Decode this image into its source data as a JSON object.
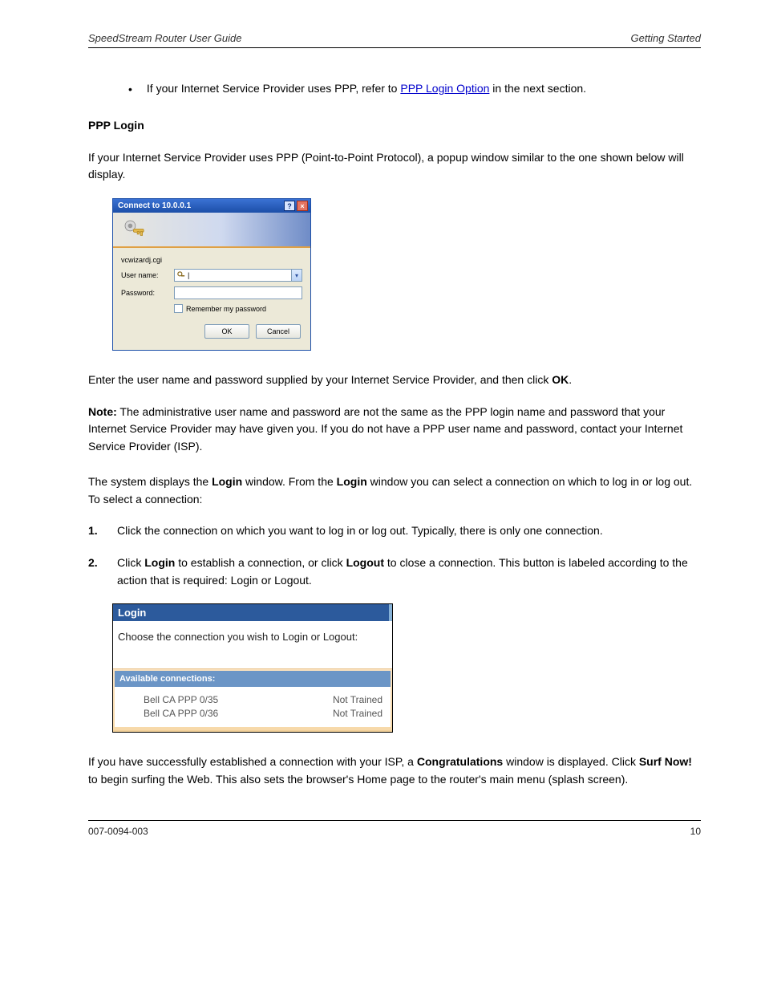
{
  "header": {
    "left": "SpeedStream Router User Guide",
    "right": "Getting Started"
  },
  "bullet": {
    "text_before": "If your Internet Service Provider uses PPP, refer to ",
    "link_text": "PPP Login Option",
    "text_after": " in the next section."
  },
  "paras": {
    "ppp_heading": "PPP Login",
    "ppp_intro": "If your Internet Service Provider uses PPP (Point-to-Point Protocol), a popup window similar to the one shown below will display."
  },
  "xp": {
    "title": "Connect to 10.0.0.1",
    "realm": "vcwizardj.cgi",
    "username_label": "User name:",
    "password_label": "Password:",
    "remember_label": "Remember my password",
    "ok": "OK",
    "cancel": "Cancel"
  },
  "after_dialog": {
    "enter_creds": "Enter the user name and password supplied by your Internet Service Provider, and then click ",
    "ok_word": "OK",
    "period": ".",
    "note_label": "Note:",
    "note_text": " The administrative user name and password are not the same as the PPP login name and password that your Internet Service Provider may have given you. If you do not have a PPP user name and password, contact your Internet Service Provider (ISP)."
  },
  "login_steps": {
    "intro": ":",
    "login_word": "Login",
    "intro_prefix": "The system displays the ",
    "intro_middle": " window. From the ",
    "intro_suffix": " window you can select a connection on which to log in or log out. To select a connection",
    "step1_num": "1.",
    "step1_text": "Click the connection on which you want to log in or log out. Typically, there is only one connection.",
    "step2_num": "2.",
    "step2_text_prefix": "Click ",
    "step2_login": "Login",
    "step2_text_mid": " to establish a connection, or click ",
    "step2_logout": "Logout",
    "step2_text_suffix": " to close a connection. This button is labeled according to the action that is required: Login or Logout."
  },
  "loginpanel": {
    "title": "Login",
    "prompt": "Choose the connection you wish to Login or Logout:",
    "subtitle": "Available connections:",
    "rows": [
      {
        "name": "Bell CA PPP 0/35",
        "status": "Not Trained"
      },
      {
        "name": "Bell CA PPP 0/36",
        "status": "Not Trained"
      }
    ]
  },
  "trailing": {
    "text_prefix": "If you have successfully established a connection with your ISP, a ",
    "congrats": "Congratulations",
    "text_mid": " window is displayed. Click ",
    "surf": "Surf Now!",
    "text_suffix": " to begin surfing the Web. This also sets the browser's Home page to the router's main menu (splash screen)."
  },
  "footer": {
    "left": "007-0094-003",
    "right": "10"
  }
}
